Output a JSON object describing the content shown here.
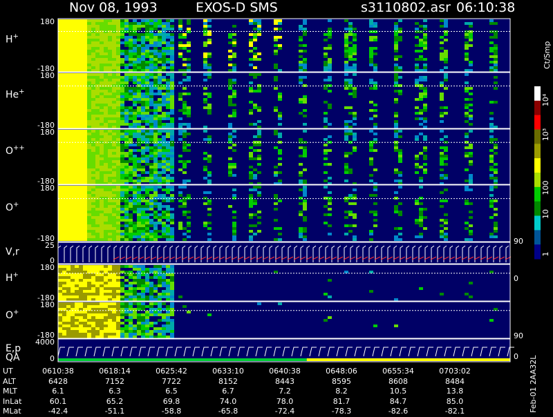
{
  "header": {
    "date": "Nov 08, 1993",
    "instrument": "EXOS-D SMS",
    "file": "s3110802.asr",
    "time": "06:10:38"
  },
  "colorbar": {
    "unit": "Ct/Smp",
    "labels": [
      {
        "text": "10⁴",
        "value": 10000
      },
      {
        "text": "10³",
        "value": 1000
      },
      {
        "text": "100",
        "value": 100
      },
      {
        "text": "10",
        "value": 10
      },
      {
        "text": "1",
        "value": 1
      }
    ],
    "colors": [
      "#ffffff",
      "#8b0000",
      "#ff0000",
      "#6b6b00",
      "#9a9a00",
      "#ffff00",
      "#aadd00",
      "#00cc00",
      "#008800",
      "#00cccc",
      "#005599",
      "#000088"
    ]
  },
  "footer_right": "Feb-01 2AA32L",
  "colors": {
    "background": "#000000",
    "panel": "#000066",
    "vr_trace": "#ff3030",
    "qa_bar_green": "#00cc33",
    "qa_bar_yellow": "#ffff00"
  },
  "table": {
    "rows": [
      {
        "label": "UT",
        "values": [
          "0610:38",
          "0618:14",
          "0625:42",
          "0633:10",
          "0640:38",
          "0648:06",
          "0655:34",
          "0703:02"
        ]
      },
      {
        "label": "ALT",
        "values": [
          "6428",
          "7152",
          "7722",
          "8152",
          "8443",
          "8595",
          "8608",
          "8484"
        ]
      },
      {
        "label": "MLT",
        "values": [
          "6.1",
          "6.3",
          "6.5",
          "6.7",
          "7.2",
          "8.2",
          "10.5",
          "13.8"
        ]
      },
      {
        "label": "InLat",
        "values": [
          "60.1",
          "65.2",
          "69.8",
          "74.0",
          "78.0",
          "81.7",
          "84.7",
          "85.0"
        ]
      },
      {
        "label": "MLat",
        "values": [
          "-42.4",
          "-51.1",
          "-58.8",
          "-65.8",
          "-72.4",
          "-78.3",
          "-82.6",
          "-82.1"
        ]
      }
    ]
  },
  "chart_data": {
    "type": "heatmap",
    "x_axis": {
      "quantity": "UT",
      "ticks": [
        "0610:38",
        "0618:14",
        "0625:42",
        "0633:10",
        "0640:38",
        "0648:06",
        "0655:34",
        "0703:02"
      ]
    },
    "panels": [
      {
        "label": "H",
        "sup": "+",
        "y_ticks": [
          "180",
          "-180"
        ],
        "ylim": [
          -180,
          180
        ]
      },
      {
        "label": "He",
        "sup": "+",
        "y_ticks": [
          "180",
          "-180"
        ],
        "ylim": [
          -180,
          180
        ]
      },
      {
        "label": "O",
        "sup": "++",
        "y_ticks": [
          "180",
          "-180"
        ],
        "ylim": [
          -180,
          180
        ]
      },
      {
        "label": "O",
        "sup": "+",
        "y_ticks": [
          "180",
          "-180"
        ],
        "ylim": [
          -180,
          180
        ]
      },
      {
        "label": "V,r",
        "sup": "",
        "y_ticks": [
          "25",
          "0"
        ],
        "ylim": [
          0,
          25
        ],
        "right_ticks": [
          "90",
          "0"
        ]
      },
      {
        "label": "H",
        "sup": "+",
        "y_ticks": [
          "180",
          "-180"
        ],
        "ylim": [
          -180,
          180
        ]
      },
      {
        "label": "O",
        "sup": "+",
        "y_ticks": [
          "180",
          "-180"
        ],
        "ylim": [
          -180,
          180
        ],
        "right_ticks": [
          "90"
        ]
      },
      {
        "label": "E,p",
        "label2": "QA",
        "sup": "",
        "y_ticks": [
          "4000",
          "0"
        ],
        "ylim": [
          0,
          4000
        ],
        "right_ticks": [
          "0"
        ]
      }
    ]
  }
}
